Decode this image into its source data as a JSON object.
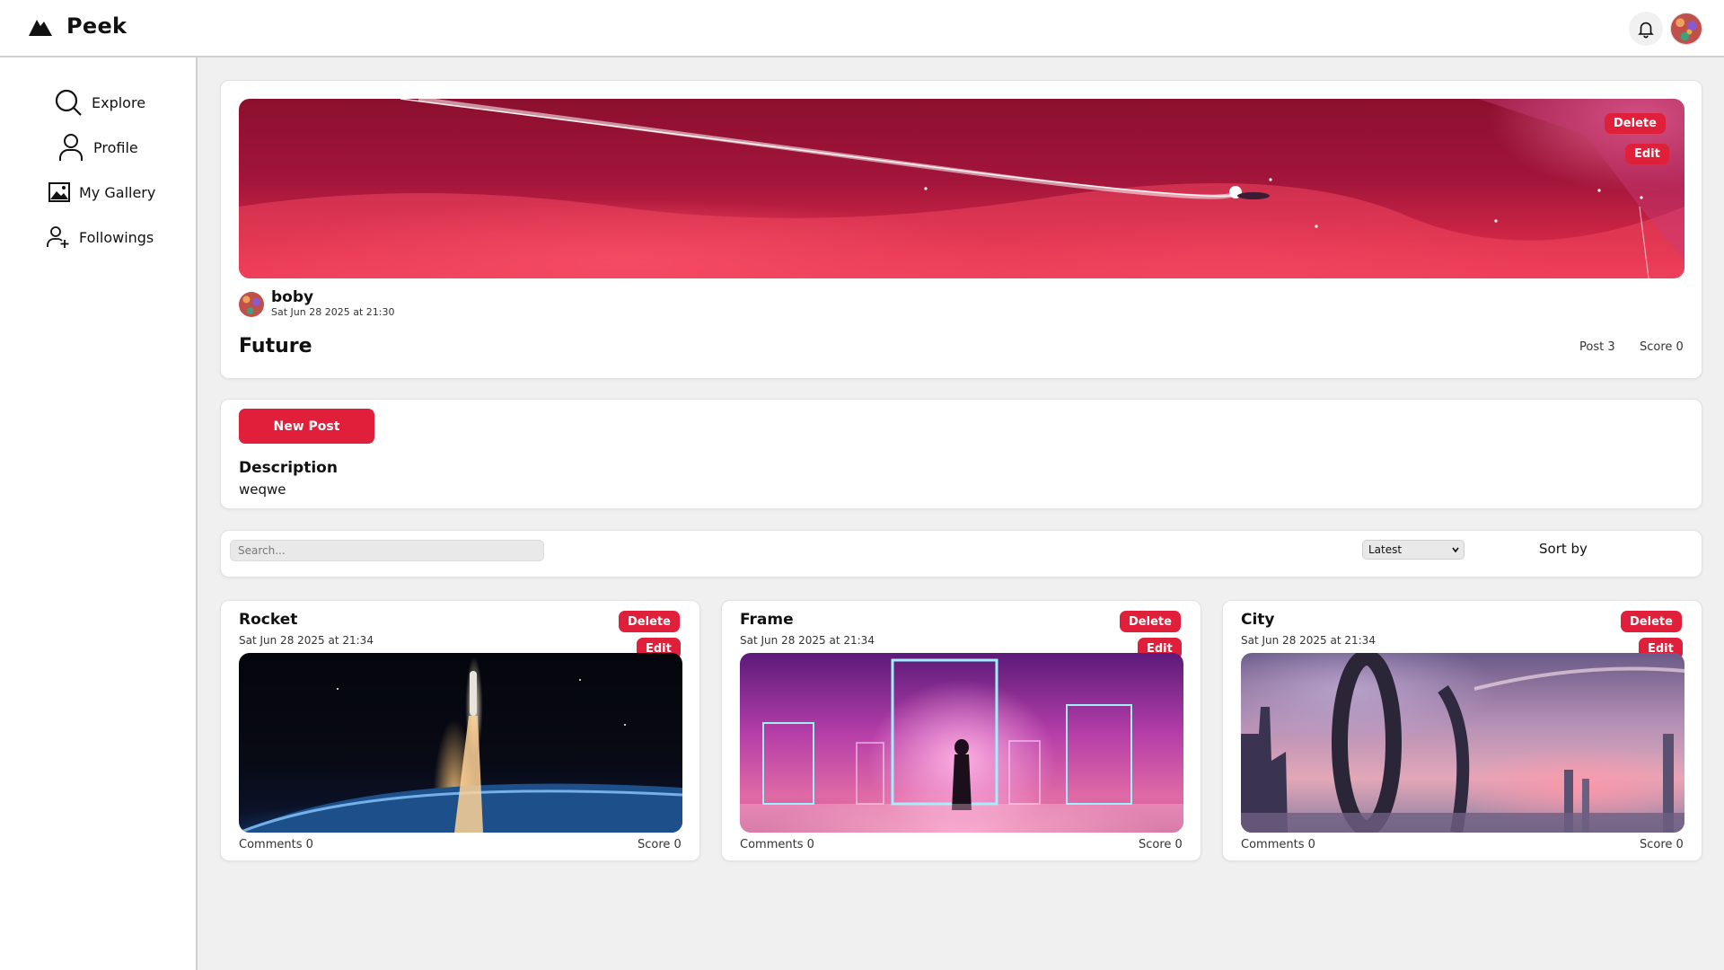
{
  "app": {
    "name": "Peek"
  },
  "header": {
    "bell_icon": "bell-icon",
    "avatar": "user-avatar"
  },
  "sidebar": {
    "items": [
      {
        "label": "Explore",
        "icon": "search-icon"
      },
      {
        "label": "Profile",
        "icon": "user-icon"
      },
      {
        "label": "My Gallery",
        "icon": "image-icon"
      },
      {
        "label": "Followings",
        "icon": "user-plus-icon"
      }
    ]
  },
  "gallery": {
    "author": "boby",
    "date": "Sat Jun 28 2025 at 21:30",
    "title": "Future",
    "post_stat": "Post 3",
    "score_stat": "Score 0",
    "delete_label": "Delete",
    "edit_label": "Edit"
  },
  "actions": {
    "new_post_label": "New Post",
    "description_heading": "Description",
    "description_text": "weqwe"
  },
  "toolbar": {
    "search_placeholder": "Search...",
    "sort_label": "Sort by",
    "sort_value": "Latest"
  },
  "posts": [
    {
      "title": "Rocket",
      "date": "Sat Jun 28 2025 at 21:34",
      "comments": "Comments 0",
      "score": "Score 0",
      "delete_label": "Delete",
      "edit_label": "Edit"
    },
    {
      "title": "Frame",
      "date": "Sat Jun 28 2025 at 21:34",
      "comments": "Comments 0",
      "score": "Score 0",
      "delete_label": "Delete",
      "edit_label": "Edit"
    },
    {
      "title": "City",
      "date": "Sat Jun 28 2025 at 21:34",
      "comments": "Comments 0",
      "score": "Score 0",
      "delete_label": "Delete",
      "edit_label": "Edit"
    }
  ],
  "colors": {
    "accent": "#e0203a",
    "background": "#f0f0f0"
  }
}
